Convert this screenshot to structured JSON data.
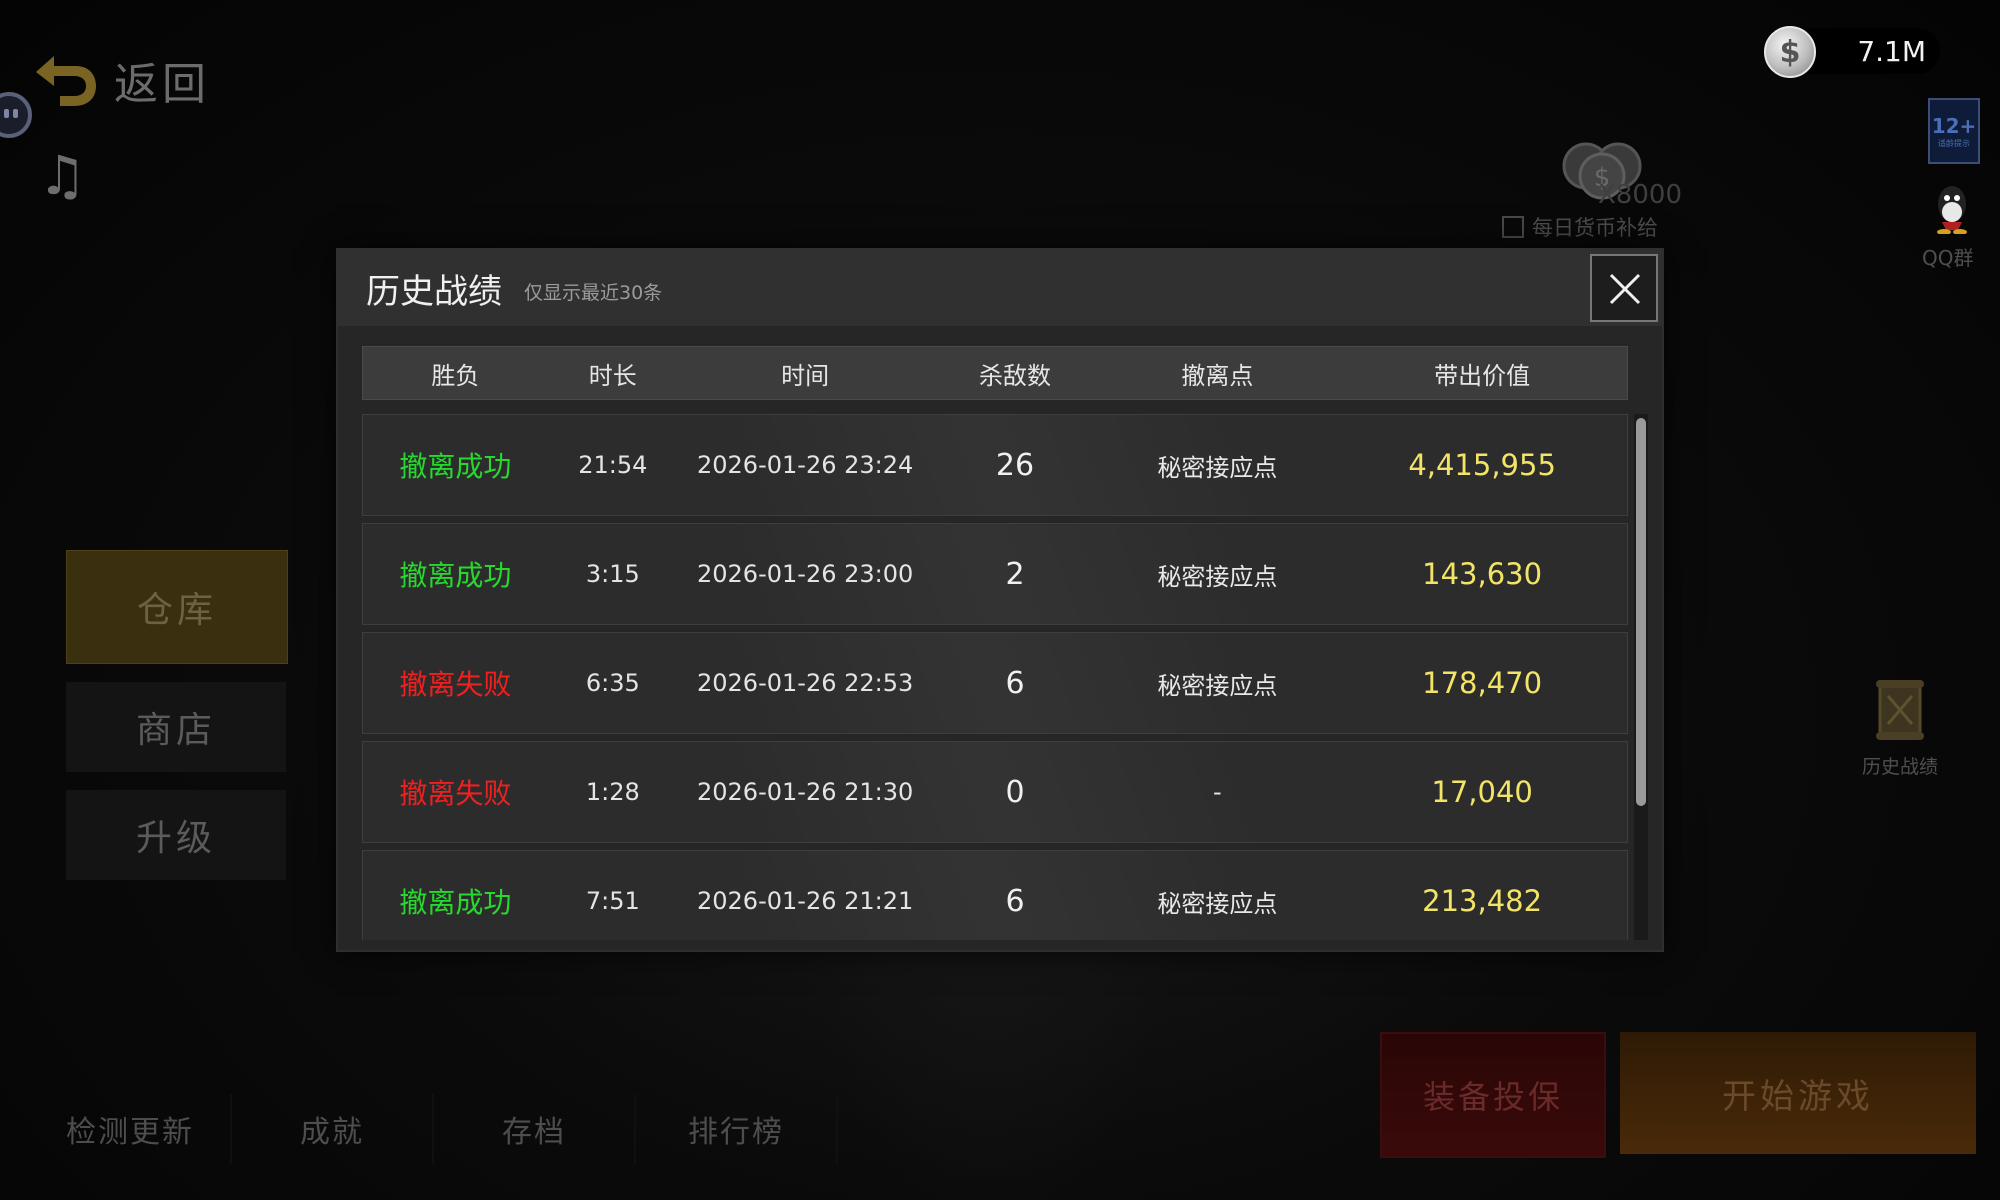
{
  "header": {
    "back_label": "返回",
    "coin_value": "7.1M",
    "age_rating": "12+",
    "age_rating_sub": "适龄提示"
  },
  "side_menu": {
    "items": [
      {
        "label": "仓库",
        "active": true
      },
      {
        "label": "商店",
        "active": false
      },
      {
        "label": "升级",
        "active": false
      }
    ]
  },
  "right_panel": {
    "daily_amount": "X8000",
    "daily_label": "每日货币补给",
    "qq_label": "QQ群",
    "history_label": "历史战绩"
  },
  "bottom_nav": {
    "items": [
      "检测更新",
      "成就",
      "存档",
      "排行榜"
    ],
    "insure_label": "装备投保",
    "start_label": "开始游戏"
  },
  "modal": {
    "title": "历史战绩",
    "subtitle": "仅显示最近30条",
    "columns": [
      "胜负",
      "时长",
      "时间",
      "杀敌数",
      "撤离点",
      "带出价值"
    ],
    "rows": [
      {
        "result": "撤离成功",
        "status": "ok",
        "duration": "21:54",
        "time": "2026-01-26 23:24",
        "kills": "26",
        "exit": "秘密接应点",
        "value": "4,415,955"
      },
      {
        "result": "撤离成功",
        "status": "ok",
        "duration": "3:15",
        "time": "2026-01-26 23:00",
        "kills": "2",
        "exit": "秘密接应点",
        "value": "143,630"
      },
      {
        "result": "撤离失败",
        "status": "fail",
        "duration": "6:35",
        "time": "2026-01-26 22:53",
        "kills": "6",
        "exit": "秘密接应点",
        "value": "178,470"
      },
      {
        "result": "撤离失败",
        "status": "fail",
        "duration": "1:28",
        "time": "2026-01-26 21:30",
        "kills": "0",
        "exit": "-",
        "value": "17,040"
      },
      {
        "result": "撤离成功",
        "status": "ok",
        "duration": "7:51",
        "time": "2026-01-26 21:21",
        "kills": "6",
        "exit": "秘密接应点",
        "value": "213,482"
      }
    ]
  },
  "colors": {
    "success": "#27d82e",
    "failure": "#ee2020",
    "value": "#f2e466"
  },
  "icons": [
    "back-arrow-icon",
    "music-icon",
    "chat-icon",
    "coin-icon",
    "qq-icon",
    "scroll-icon",
    "close-icon"
  ]
}
